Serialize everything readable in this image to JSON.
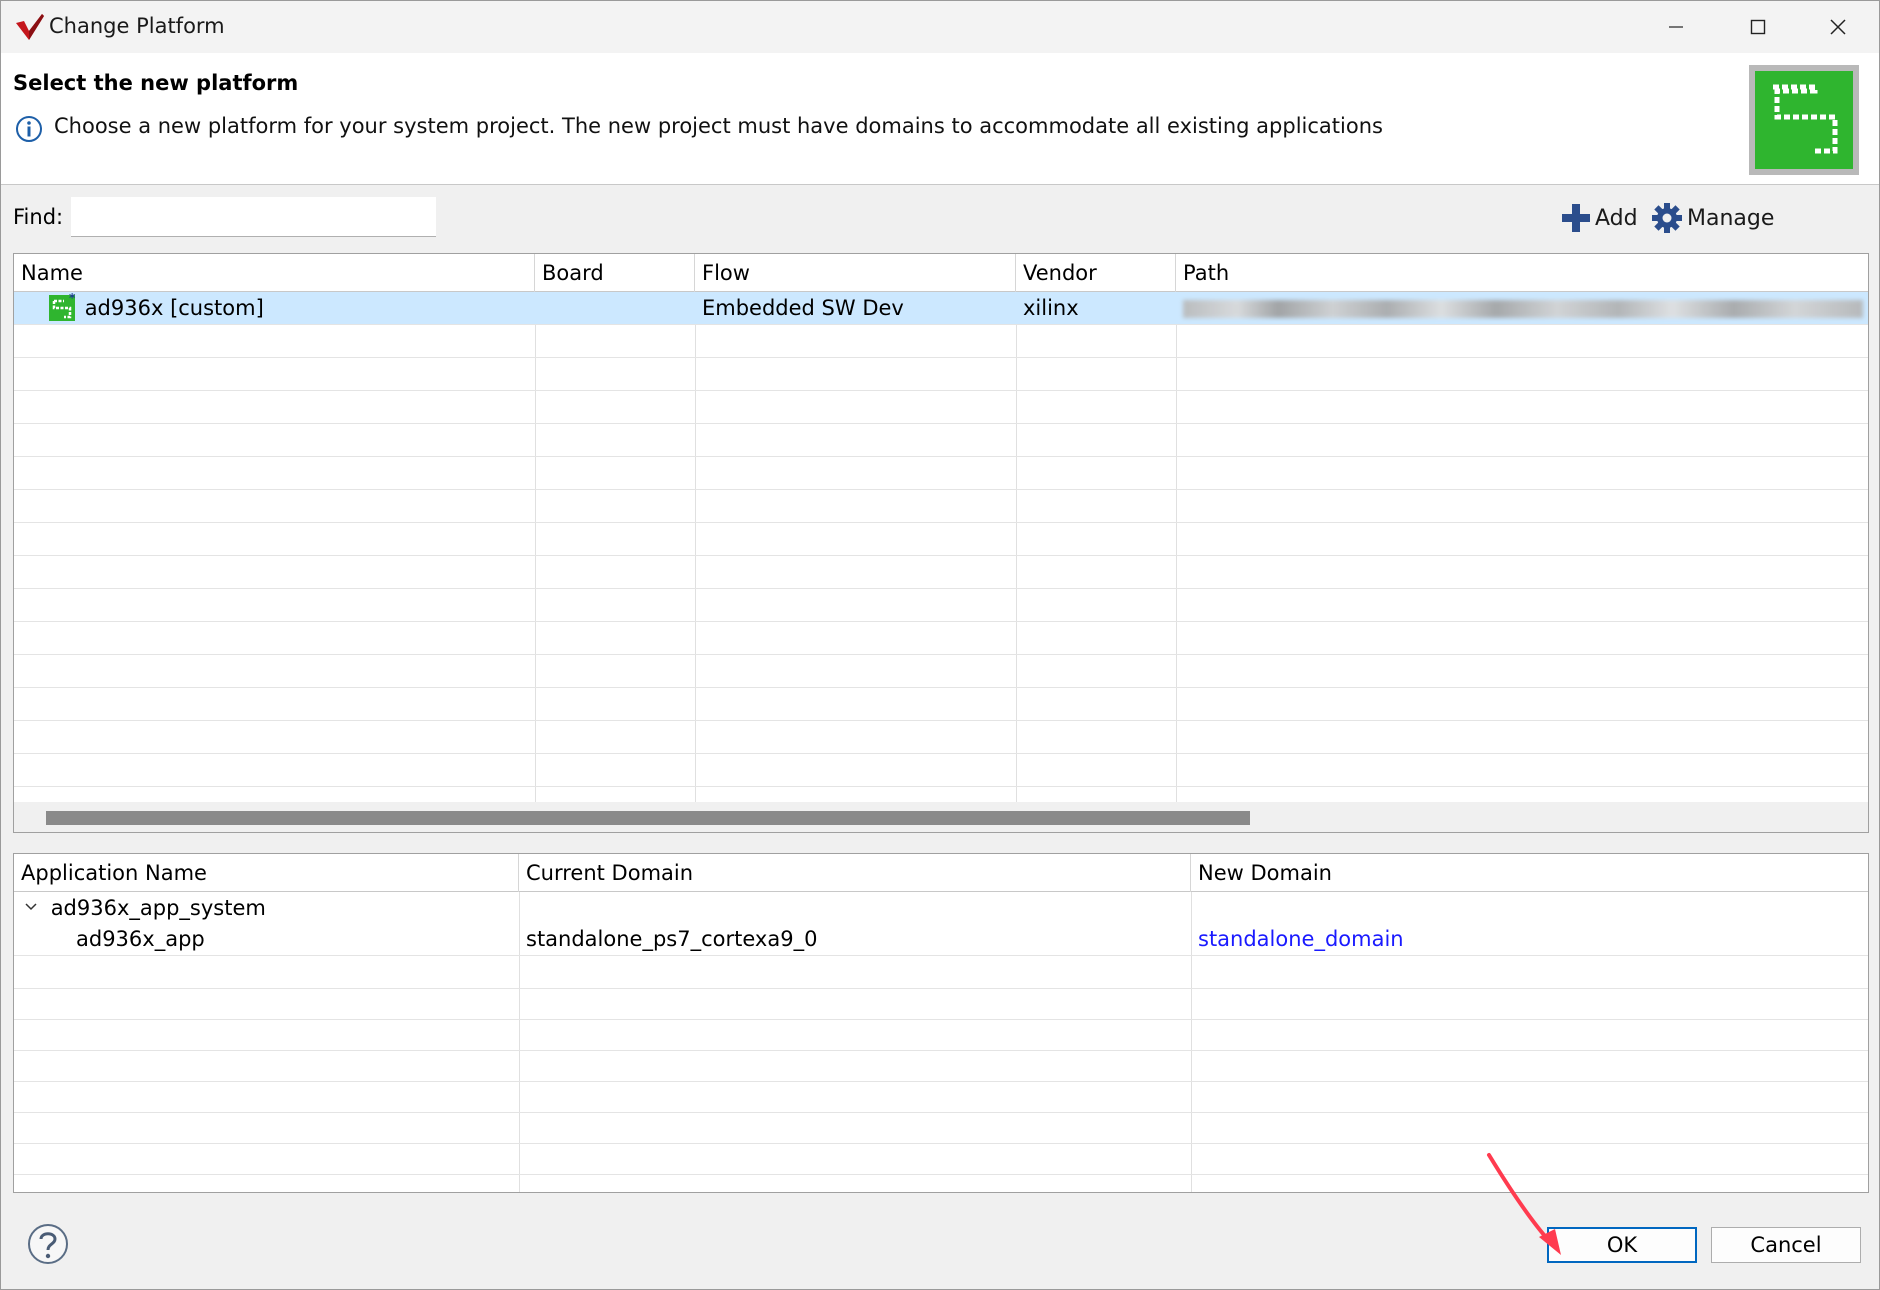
{
  "window": {
    "title": "Change Platform"
  },
  "header": {
    "title": "Select the new platform",
    "message": "Choose a new platform for your system project. The new project must have domains to accommodate all existing applications"
  },
  "find": {
    "label": "Find:",
    "value": ""
  },
  "toolbar": {
    "add_label": "Add",
    "manage_label": "Manage"
  },
  "platform_table": {
    "columns": [
      "Name",
      "Board",
      "Flow",
      "Vendor",
      "Path"
    ],
    "rows": [
      {
        "name": "ad936x [custom]",
        "board": "",
        "flow": "Embedded SW Dev",
        "vendor": "xilinx",
        "path": ""
      }
    ]
  },
  "app_table": {
    "columns": [
      "Application Name",
      "Current Domain",
      "New Domain"
    ],
    "rows": [
      {
        "name": "ad936x_app_system",
        "current_domain": "",
        "new_domain": ""
      },
      {
        "name": "ad936x_app",
        "current_domain": "standalone_ps7_cortexa9_0",
        "new_domain": "standalone_domain"
      }
    ]
  },
  "buttons": {
    "ok": "OK",
    "cancel": "Cancel"
  },
  "colors": {
    "selection": "#cce8ff",
    "link": "#1a1aff",
    "logo_green": "#2fb52f",
    "accent": "#0067c0"
  }
}
